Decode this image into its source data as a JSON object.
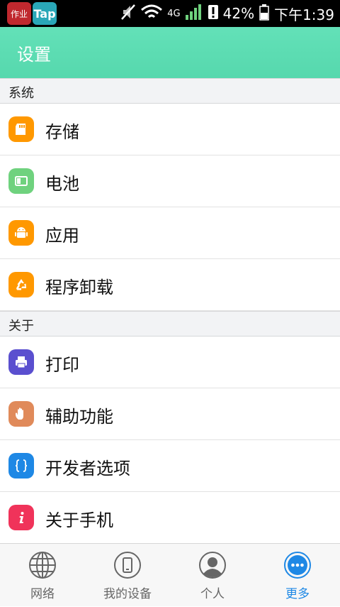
{
  "status_bar": {
    "notif_zuoye": "作业",
    "notif_tap": "Tap",
    "network_type": "4G",
    "battery_percent": "42%",
    "time": "下午1:39",
    "icons": [
      "mute-icon",
      "wifi-icon",
      "signal-icon",
      "alert-icon",
      "battery-icon"
    ]
  },
  "header": {
    "title": "设置",
    "color": "#5cdcb2"
  },
  "sections": [
    {
      "label": "系统",
      "items": [
        {
          "label": "存储",
          "icon": "storage-icon",
          "color": "#ff9800"
        },
        {
          "label": "电池",
          "icon": "battery-icon",
          "color": "#6fd27e"
        },
        {
          "label": "应用",
          "icon": "android-icon",
          "color": "#ff9800"
        },
        {
          "label": "程序卸载",
          "icon": "recycle-icon",
          "color": "#ff9800"
        }
      ]
    },
    {
      "label": "关于",
      "items": [
        {
          "label": "打印",
          "icon": "printer-icon",
          "color": "#5a4fcf"
        },
        {
          "label": "辅助功能",
          "icon": "hand-icon",
          "color": "#e08a5a"
        },
        {
          "label": "开发者选项",
          "icon": "braces-icon",
          "color": "#1e88e5"
        },
        {
          "label": "关于手机",
          "icon": "info-icon",
          "color": "#f0335a"
        }
      ]
    }
  ],
  "bottom_nav": [
    {
      "label": "网络",
      "icon": "globe-icon",
      "active": false
    },
    {
      "label": "我的设备",
      "icon": "device-icon",
      "active": false
    },
    {
      "label": "个人",
      "icon": "person-icon",
      "active": false
    },
    {
      "label": "更多",
      "icon": "more-icon",
      "active": true
    }
  ],
  "accent_color": "#1e88e5"
}
